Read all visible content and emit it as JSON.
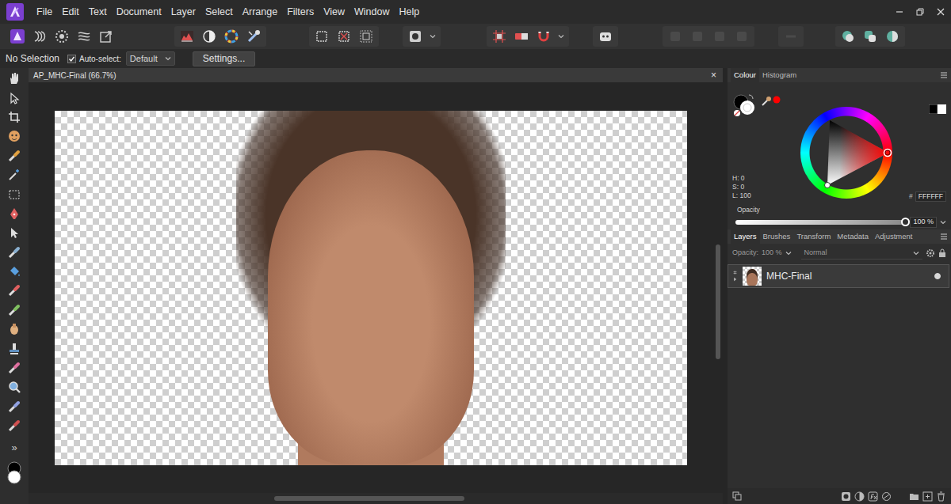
{
  "menu": [
    "File",
    "Edit",
    "Text",
    "Document",
    "Layer",
    "Select",
    "Arrange",
    "Filters",
    "View",
    "Window",
    "Help"
  ],
  "context_bar": {
    "selection": "No Selection",
    "auto_select": {
      "label": "Auto-select:",
      "checked": true
    },
    "select_mode": "Default",
    "settings": "Settings..."
  },
  "document": {
    "title": "AP_MHC-Final (66.7%)",
    "close": "×"
  },
  "tools_more": "»",
  "colour_panel": {
    "tabs": [
      {
        "label": "Colour",
        "selected": true
      },
      {
        "label": "Histogram",
        "selected": false
      }
    ],
    "hsl": [
      "H: 0",
      "S: 0",
      "L: 100"
    ],
    "hex_label": "#",
    "hex": "FFFFFF",
    "opacity_label": "Opacity",
    "opacity_reading": "100 %",
    "opacity_level": 1
  },
  "layers_panel": {
    "tabs": [
      {
        "label": "Layers",
        "selected": true
      },
      {
        "label": "Brushes",
        "selected": false
      },
      {
        "label": "Transform",
        "selected": false
      },
      {
        "label": "Metadata",
        "selected": false
      },
      {
        "label": "Adjustment",
        "selected": false
      }
    ],
    "opacity_label": "Opacity:",
    "opacity": "100 %",
    "blend_mode": "Normal",
    "layers": [
      {
        "name": "MHC-Final",
        "selected": true,
        "visible": true
      }
    ]
  }
}
